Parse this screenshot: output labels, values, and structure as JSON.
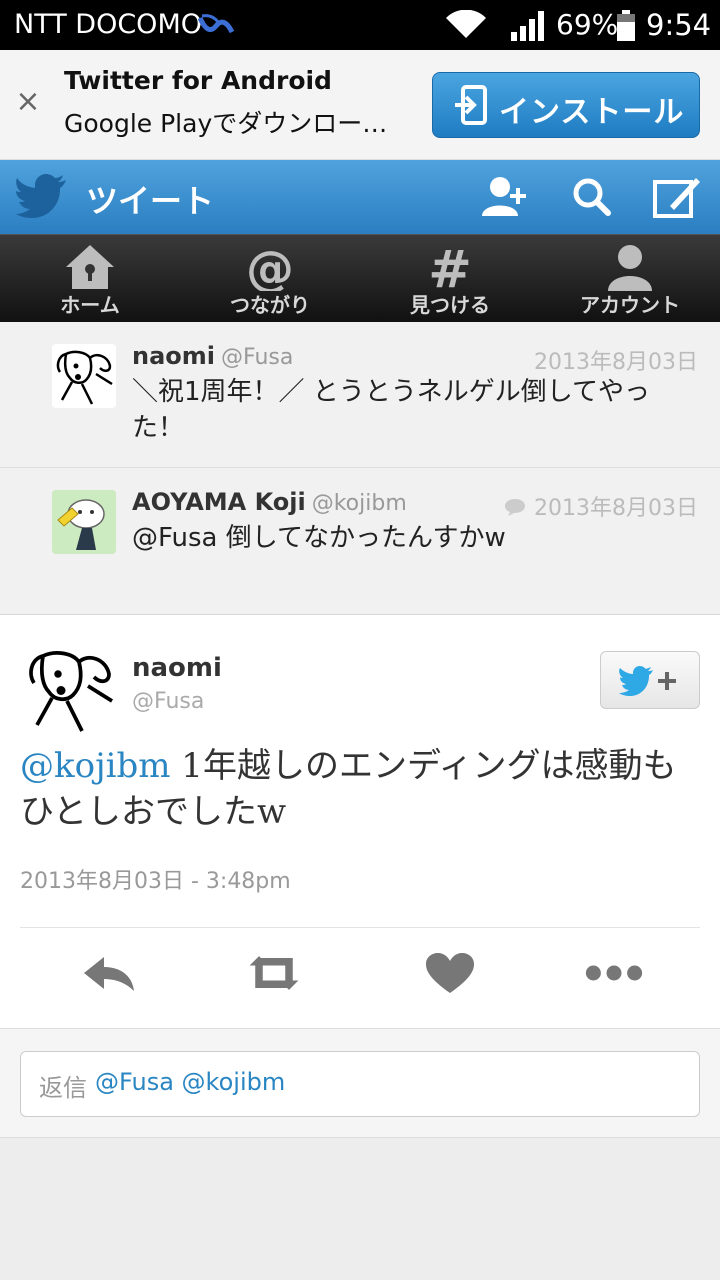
{
  "status_bar": {
    "carrier": "NTT DOCOMO",
    "battery": "69%",
    "time": "9:54"
  },
  "banner": {
    "title": "Twitter for Android",
    "subtitle": "Google Playでダウンロー…",
    "install_label": "インストール",
    "close_label": "×"
  },
  "header": {
    "title": "ツイート",
    "brand_color": "#2b7fc2"
  },
  "tabs": [
    {
      "label": "ホーム",
      "icon": "home-icon"
    },
    {
      "label": "つながり",
      "icon": "at-icon"
    },
    {
      "label": "見つける",
      "icon": "hash-icon"
    },
    {
      "label": "アカウント",
      "icon": "person-icon"
    }
  ],
  "conversation": [
    {
      "name": "naomi",
      "handle": "@Fusa",
      "date": "2013年8月03日",
      "text": "＼祝1周年！／ とうとうネルゲル倒してやった！"
    },
    {
      "name": "AOYAMA Koji",
      "handle": "@kojibm",
      "date": "2013年8月03日",
      "text": "@Fusa 倒してなかったんすかw"
    }
  ],
  "main_tweet": {
    "name": "naomi",
    "handle": "@Fusa",
    "mention": "@kojibm",
    "text": " 1年越しのエンディングは感動もひとしおでしたw",
    "timestamp": "2013年8月03日 - 3:48pm"
  },
  "reply": {
    "prefix": "返信",
    "mentions": "@Fusa @kojibm"
  }
}
